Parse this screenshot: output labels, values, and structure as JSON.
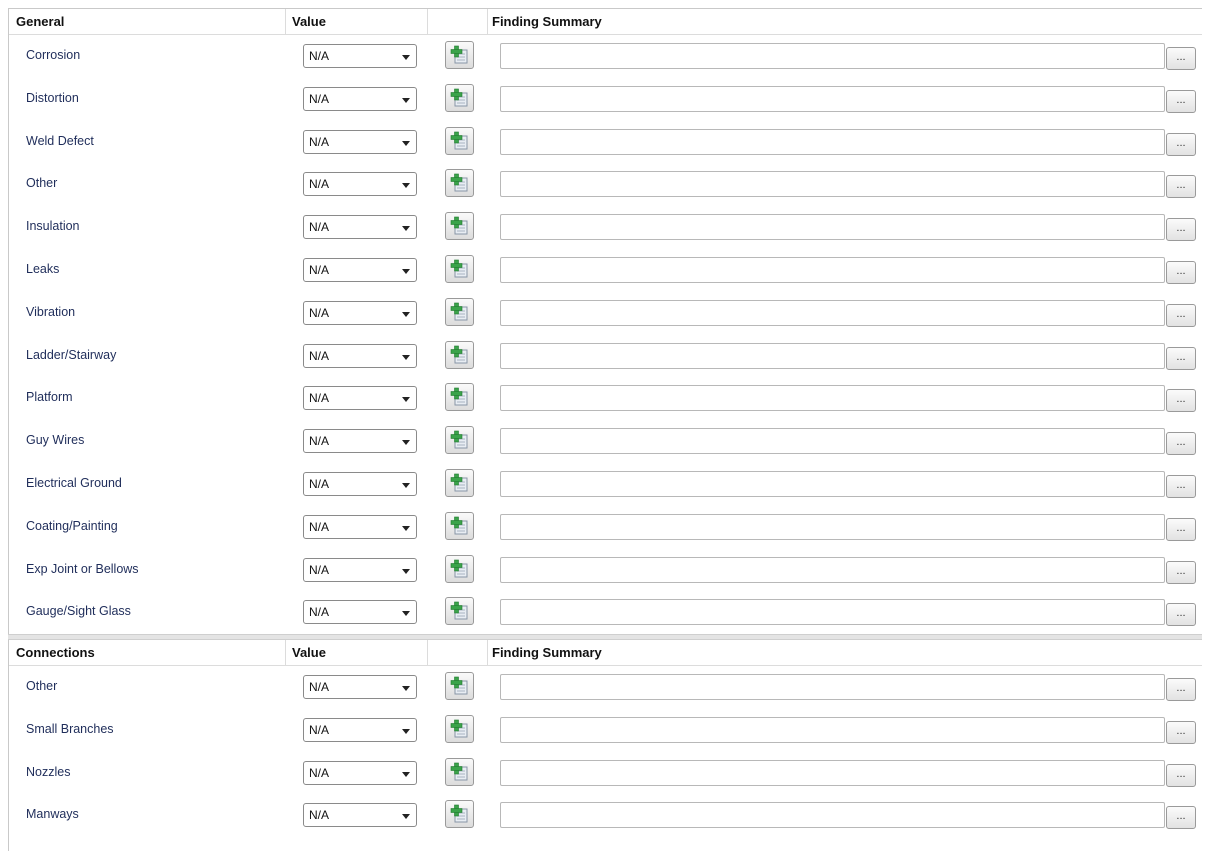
{
  "general": {
    "header": {
      "label": "General",
      "value": "Value",
      "finding": "Finding Summary"
    },
    "rows": [
      {
        "label": "Corrosion",
        "value": "N/A",
        "more": "..."
      },
      {
        "label": "Distortion",
        "value": "N/A",
        "more": "..."
      },
      {
        "label": "Weld Defect",
        "value": "N/A",
        "more": "..."
      },
      {
        "label": "Other",
        "value": "N/A",
        "more": "..."
      },
      {
        "label": "Insulation",
        "value": "N/A",
        "more": "..."
      },
      {
        "label": "Leaks",
        "value": "N/A",
        "more": "..."
      },
      {
        "label": "Vibration",
        "value": "N/A",
        "more": "..."
      },
      {
        "label": "Ladder/Stairway",
        "value": "N/A",
        "more": "..."
      },
      {
        "label": "Platform",
        "value": "N/A",
        "more": "..."
      },
      {
        "label": "Guy Wires",
        "value": "N/A",
        "more": "..."
      },
      {
        "label": "Electrical Ground",
        "value": "N/A",
        "more": "..."
      },
      {
        "label": "Coating/Painting",
        "value": "N/A",
        "more": "..."
      },
      {
        "label": "Exp Joint or Bellows",
        "value": "N/A",
        "more": "..."
      },
      {
        "label": "Gauge/Sight Glass",
        "value": "N/A",
        "more": "..."
      }
    ]
  },
  "connections": {
    "header": {
      "label": "Connections",
      "value": "Value",
      "finding": "Finding Summary"
    },
    "rows": [
      {
        "label": "Other",
        "value": "N/A",
        "more": "..."
      },
      {
        "label": "Small Branches",
        "value": "N/A",
        "more": "..."
      },
      {
        "label": "Nozzles",
        "value": "N/A",
        "more": "..."
      },
      {
        "label": "Manways",
        "value": "N/A",
        "more": "..."
      }
    ]
  },
  "icons": {
    "add_finding": "add-finding-icon",
    "dropdown": "chevron-down-icon"
  },
  "colors": {
    "label_text": "#1f2d5a",
    "add_icon_green": "#3aa34a"
  }
}
